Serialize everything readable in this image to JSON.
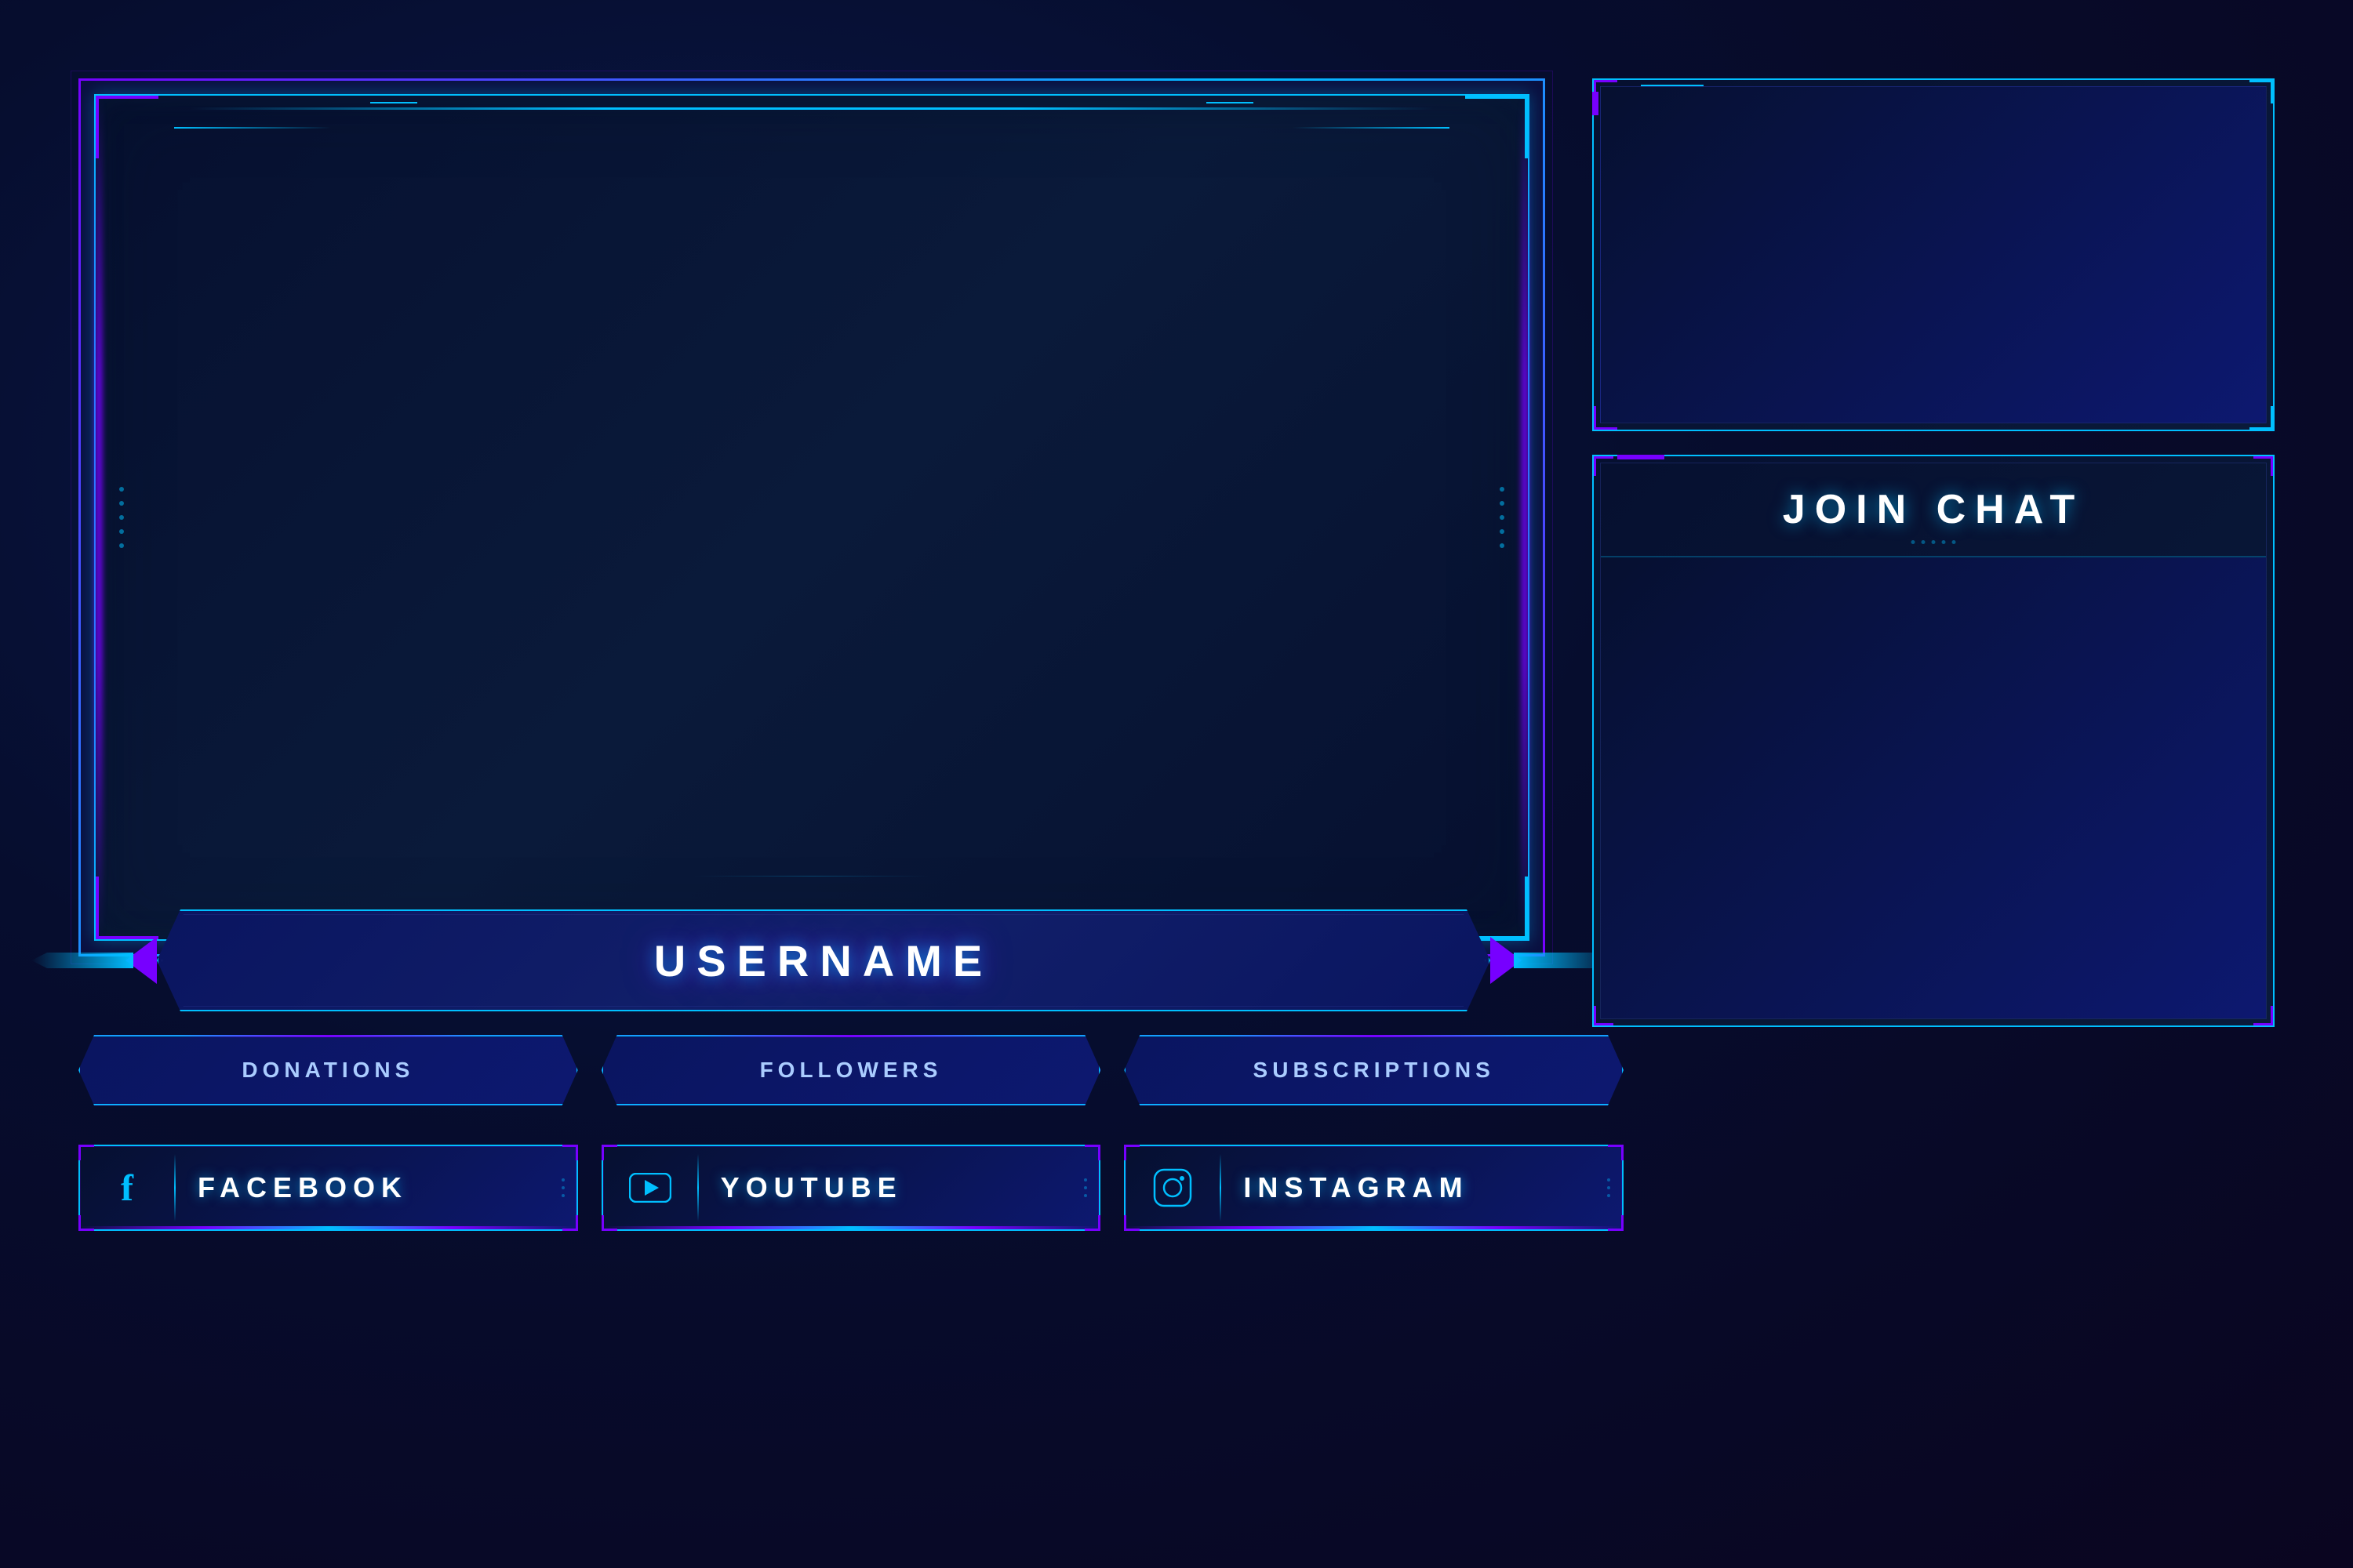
{
  "background": {
    "color": "#060d2e"
  },
  "main_frame": {
    "label": "main-video-frame"
  },
  "username_panel": {
    "text": "USERNAME"
  },
  "stat_panels": [
    {
      "label": "DONATIONS"
    },
    {
      "label": "FOLLOWERS"
    },
    {
      "label": "SUBSCRIPTIONS"
    }
  ],
  "social_panels": [
    {
      "label": "FACEBOOK",
      "icon": "f",
      "icon_type": "facebook"
    },
    {
      "label": "YOUTUBE",
      "icon": "▶",
      "icon_type": "youtube"
    },
    {
      "label": "INSTAGRAM",
      "icon": "◉",
      "icon_type": "instagram"
    }
  ],
  "webcam_panel": {
    "label": "webcam-panel"
  },
  "chat_panel": {
    "title": "JOIN CHAT",
    "label": "chat-panel"
  },
  "colors": {
    "cyan": "#00bfff",
    "purple": "#7700ff",
    "dark_bg": "#061030",
    "mid_bg": "#0a1a3a",
    "text_white": "#ffffff"
  }
}
